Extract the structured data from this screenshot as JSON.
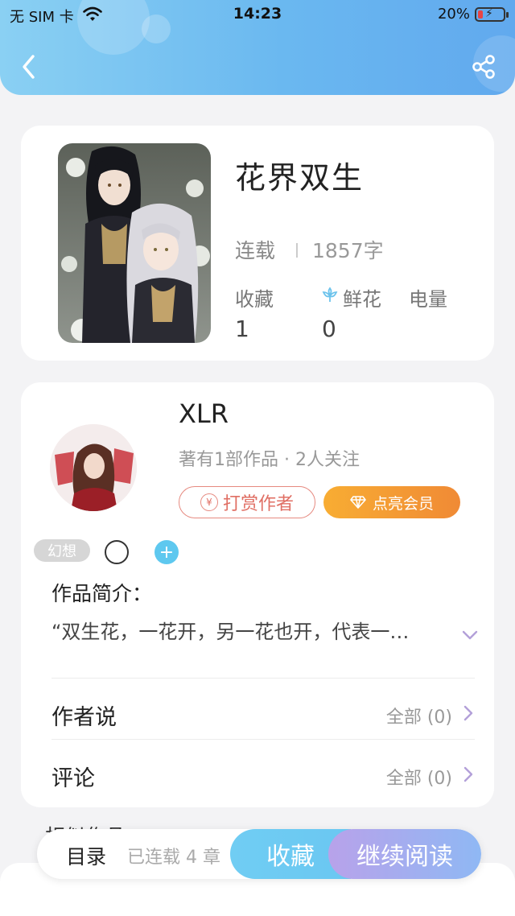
{
  "status_bar": {
    "carrier": "无 SIM 卡",
    "time": "14:23",
    "battery": "20%",
    "battery_level": 0.2
  },
  "header": {
    "back_icon": "chevron-left-icon",
    "share_icon": "share-icon"
  },
  "book": {
    "title": "花界双生",
    "status": "连载",
    "word_count": "1857字",
    "stats": [
      {
        "label": "收藏",
        "value": "1"
      },
      {
        "label": "鲜花",
        "value": "0",
        "icon": "flower-icon"
      },
      {
        "label": "电量",
        "value": ""
      }
    ]
  },
  "author": {
    "name": "XLR",
    "meta": "著有1部作品 · 2人关注",
    "tip_label": "打赏作者",
    "tip_icon_text": "¥",
    "vip_label": "点亮会员"
  },
  "tags": {
    "genre": "幻想",
    "add_symbol": "+"
  },
  "intro": {
    "title": "作品简介：",
    "text": "“双生花，一花开，另一花也开，代表一…"
  },
  "rows": [
    {
      "title": "作者说",
      "value": "全部 (0)"
    },
    {
      "title": "评论",
      "value": "全部 (0)"
    }
  ],
  "peek_section": "相似作品",
  "bottom_bar": {
    "toc_label": "目录",
    "chapters_label": "已连载 4 章",
    "favorite_label": "收藏",
    "continue_label": "继续阅读"
  },
  "colors": {
    "header_gradient": [
      "#8ad0f3",
      "#61a9ee"
    ],
    "tip_accent": "#e06f64",
    "vip_gradient": [
      "#f8ad33",
      "#f08a35"
    ],
    "favorite_gradient": [
      "#70cdf3",
      "#6ac7f2"
    ],
    "read_gradient": [
      "#b8a2ea",
      "#8fb8f4"
    ]
  }
}
